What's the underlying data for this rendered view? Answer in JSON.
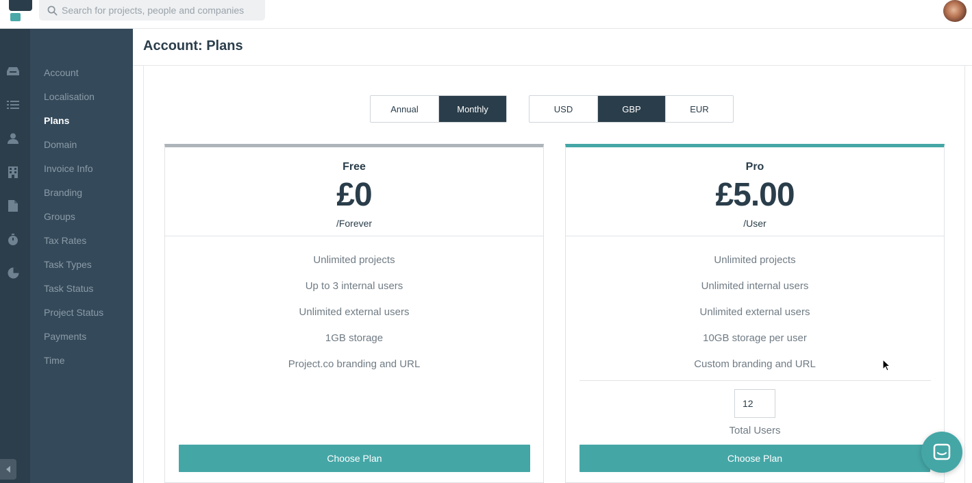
{
  "topbar": {
    "search_placeholder": "Search for projects, people and companies"
  },
  "rail_icons": [
    "inbox-icon",
    "list-icon",
    "person-icon",
    "building-icon",
    "document-icon",
    "stopwatch-icon",
    "pie-chart-icon"
  ],
  "sidebar": {
    "items": [
      {
        "label": "Account"
      },
      {
        "label": "Localisation"
      },
      {
        "label": "Plans"
      },
      {
        "label": "Domain"
      },
      {
        "label": "Invoice Info"
      },
      {
        "label": "Branding"
      },
      {
        "label": "Groups"
      },
      {
        "label": "Tax Rates"
      },
      {
        "label": "Task Types"
      },
      {
        "label": "Task Status"
      },
      {
        "label": "Project Status"
      },
      {
        "label": "Payments"
      },
      {
        "label": "Time"
      }
    ],
    "active": "Plans"
  },
  "page": {
    "title": "Account: Plans"
  },
  "billing_toggle": {
    "annual": "Annual",
    "monthly": "Monthly",
    "selected": "Monthly"
  },
  "currency_toggle": {
    "usd": "USD",
    "gbp": "GBP",
    "eur": "EUR",
    "selected": "GBP"
  },
  "plans": {
    "free": {
      "name": "Free",
      "price": "£0",
      "period": "/Forever",
      "features": [
        "Unlimited projects",
        "Up to 3 internal users",
        "Unlimited external users",
        "1GB storage",
        "Project.co branding and URL"
      ],
      "button": "Choose Plan"
    },
    "pro": {
      "name": "Pro",
      "price": "£5.00",
      "period": "/User",
      "features": [
        "Unlimited projects",
        "Unlimited internal users",
        "Unlimited external users",
        "10GB storage per user",
        "Custom branding and URL"
      ],
      "users_value": "12",
      "users_label": "Total Users",
      "button": "Choose Plan"
    }
  },
  "colors": {
    "accent": "#45a6a6",
    "dark": "#2a3d4a",
    "sidebar": "#34495a",
    "rail": "#2c3e4b"
  }
}
